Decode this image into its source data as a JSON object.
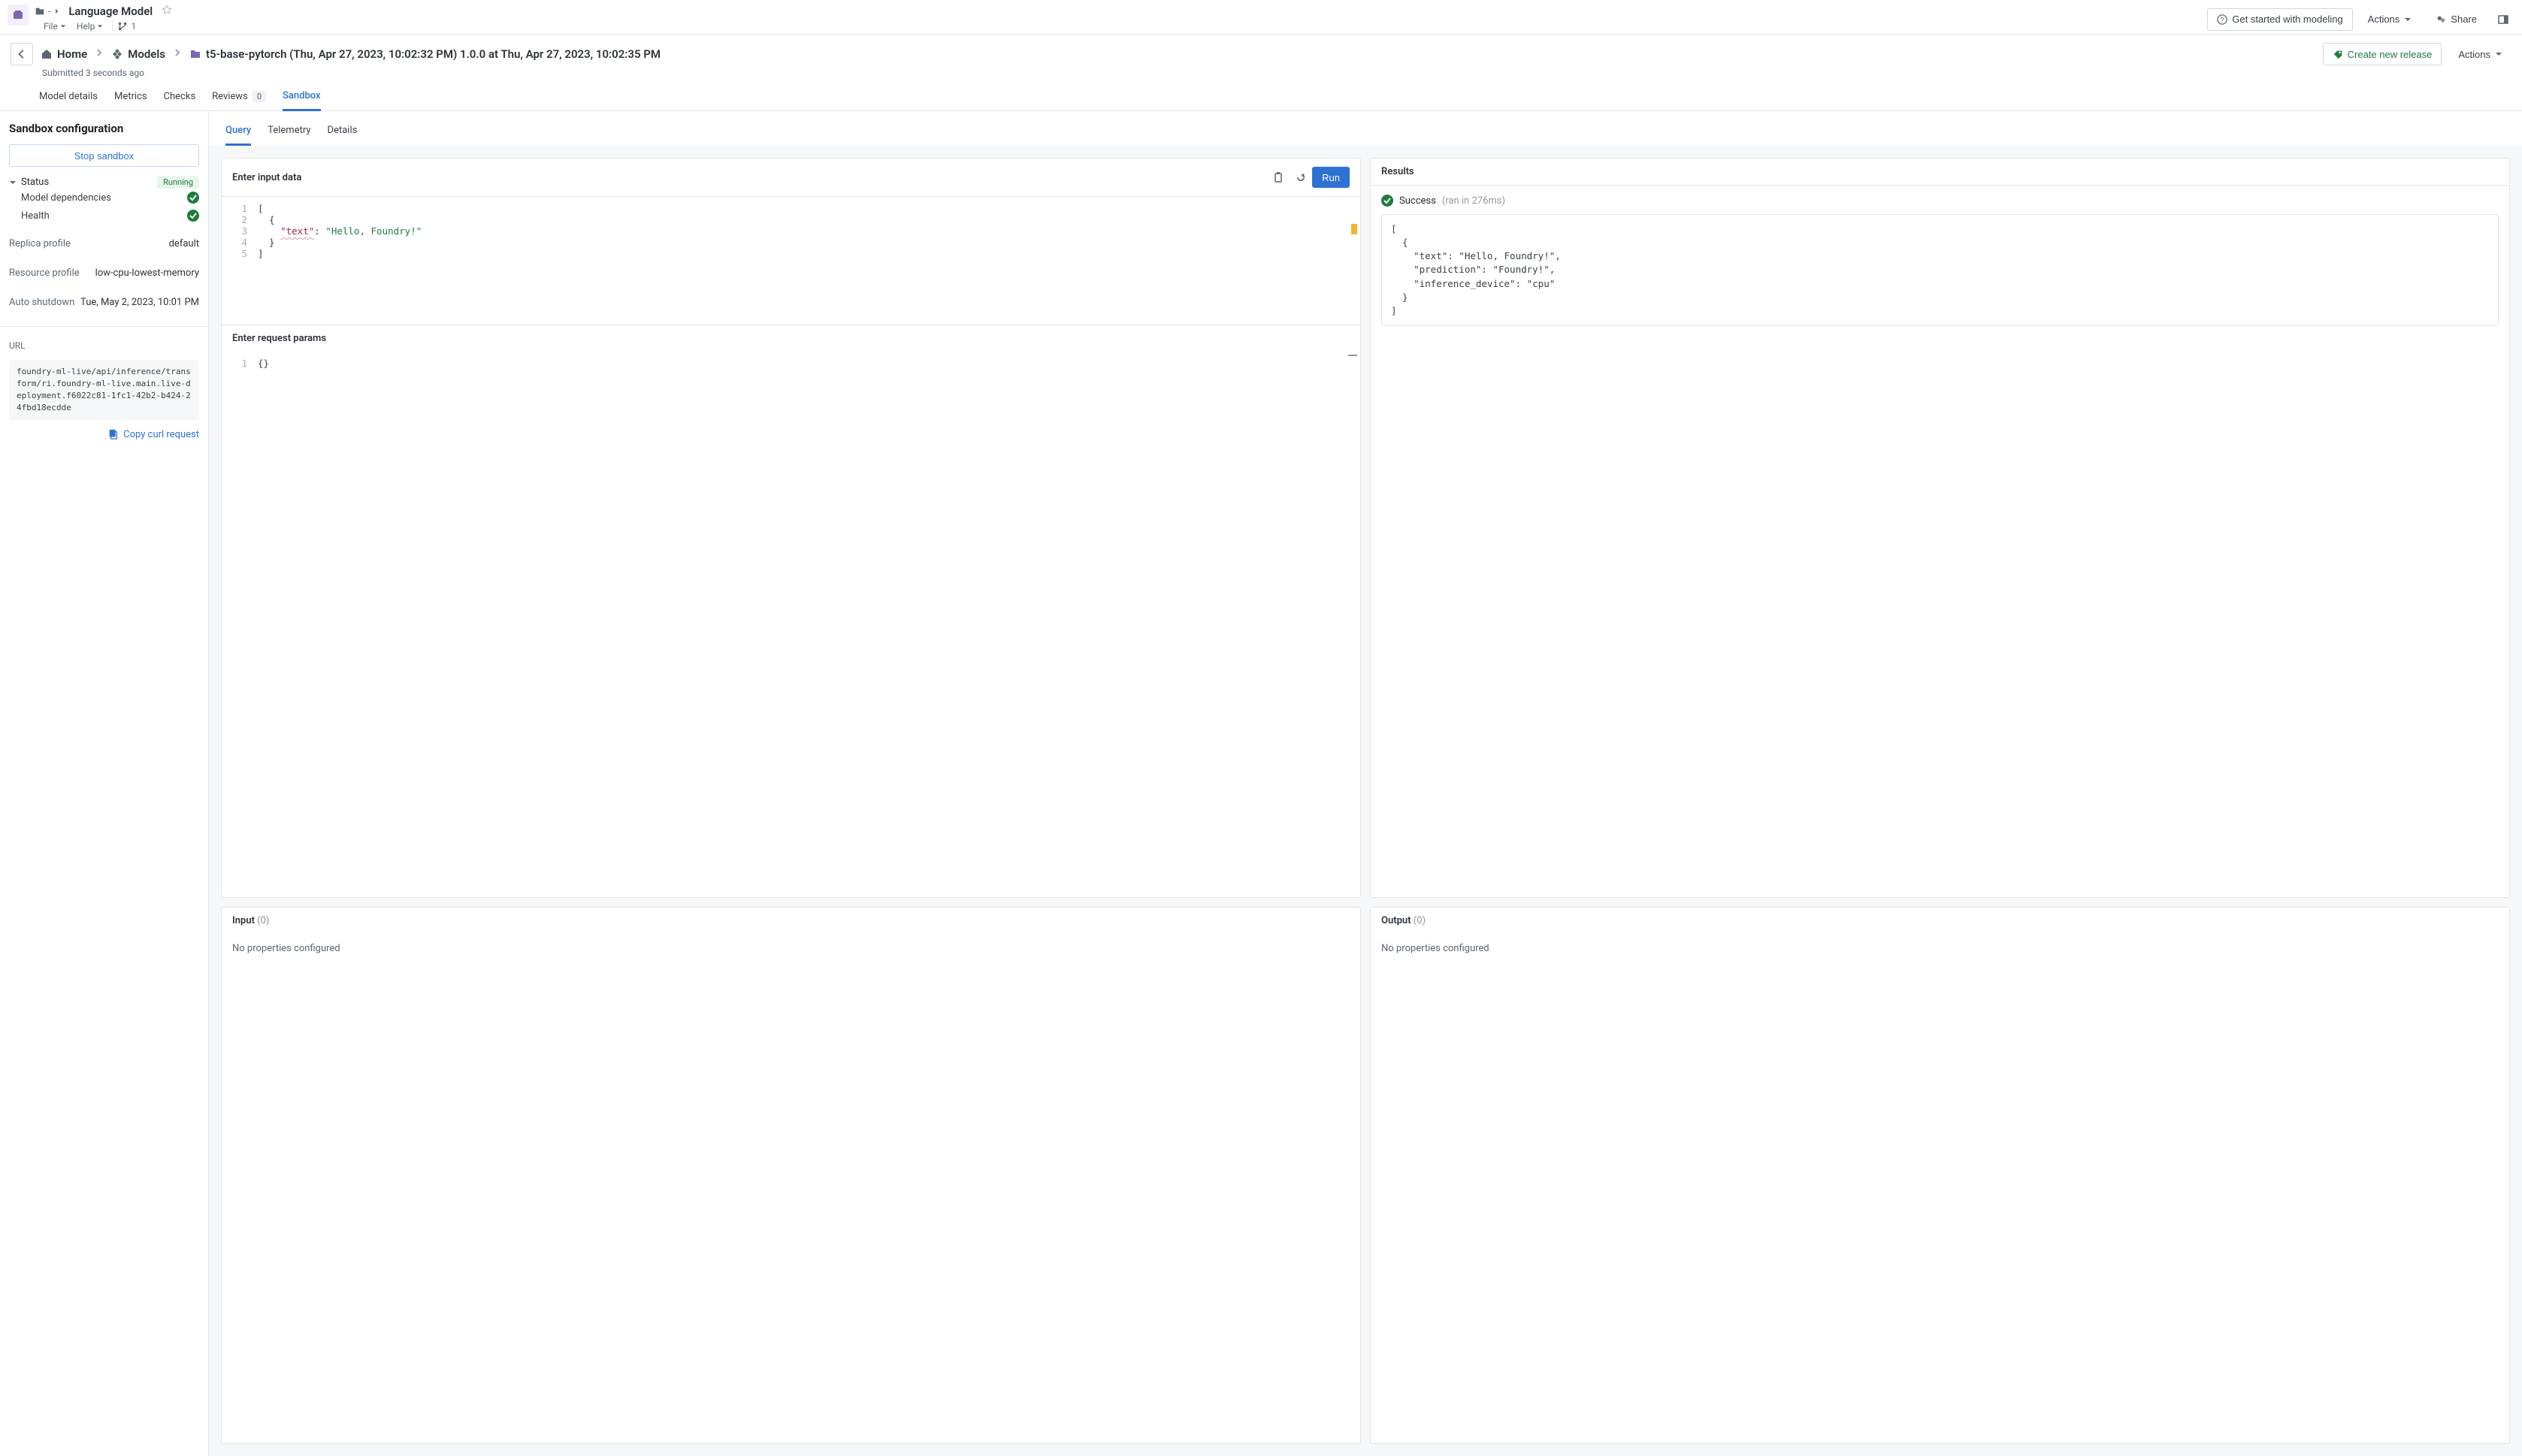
{
  "titlebar": {
    "project_chip": "-",
    "title": "Language Model",
    "file_menu": "File",
    "help_menu": "Help",
    "branch_count": "1",
    "get_started": "Get started with modeling",
    "actions": "Actions",
    "share": "Share"
  },
  "breadcrumb": {
    "home": "Home",
    "models": "Models",
    "version": "t5-base-pytorch (Thu, Apr 27, 2023, 10:02:32 PM) 1.0.0 at Thu, Apr 27, 2023, 10:02:35 PM",
    "create_release": "Create new release",
    "actions": "Actions",
    "submitted": "Submitted 3 seconds ago"
  },
  "primary_tabs": {
    "model_details": "Model details",
    "metrics": "Metrics",
    "checks": "Checks",
    "reviews": "Reviews",
    "reviews_count": "0",
    "sandbox": "Sandbox"
  },
  "sidebar": {
    "heading": "Sandbox configuration",
    "stop": "Stop sandbox",
    "status_label": "Status",
    "status_value": "Running",
    "model_deps": "Model dependencies",
    "health": "Health",
    "replica_label": "Replica profile",
    "replica_value": "default",
    "resource_label": "Resource profile",
    "resource_value": "low-cpu-lowest-memory",
    "shutdown_label": "Auto shutdown",
    "shutdown_value": "Tue, May 2, 2023, 10:01 PM",
    "url_label": "URL",
    "url_value": "foundry-ml-live/api/inference/transform/ri.foundry-ml-live.main.live-deployment.f6022c81-1fc1-42b2-b424-24fbd18ecdde",
    "copy_curl": "Copy curl request"
  },
  "subtabs": {
    "query": "Query",
    "telemetry": "Telemetry",
    "details": "Details"
  },
  "input_panel": {
    "title": "Enter input data",
    "run": "Run",
    "lines": {
      "l1_num": "1",
      "l1_code": "[",
      "l2_num": "2",
      "l2_code": "  {",
      "l3_num": "3",
      "l3_pre": "    ",
      "l3_key": "\"text\"",
      "l3_mid": ": ",
      "l3_val": "\"Hello, Foundry!\"",
      "l4_num": "4",
      "l4_code": "  }",
      "l5_num": "5",
      "l5_code": "]"
    }
  },
  "params_panel": {
    "title": "Enter request params",
    "line_num": "1",
    "line_code": "{}"
  },
  "results_panel": {
    "title": "Results",
    "status": "Success",
    "timing": "(ran in 276ms)",
    "json": "[\n  {\n    \"text\": \"Hello, Foundry!\",\n    \"prediction\": \"Foundry!\",\n    \"inference_device\": \"cpu\"\n  }\n]"
  },
  "input_schema": {
    "title": "Input",
    "count": "(0)",
    "empty": "No properties configured"
  },
  "output_schema": {
    "title": "Output",
    "count": "(0)",
    "empty": "No properties configured"
  }
}
